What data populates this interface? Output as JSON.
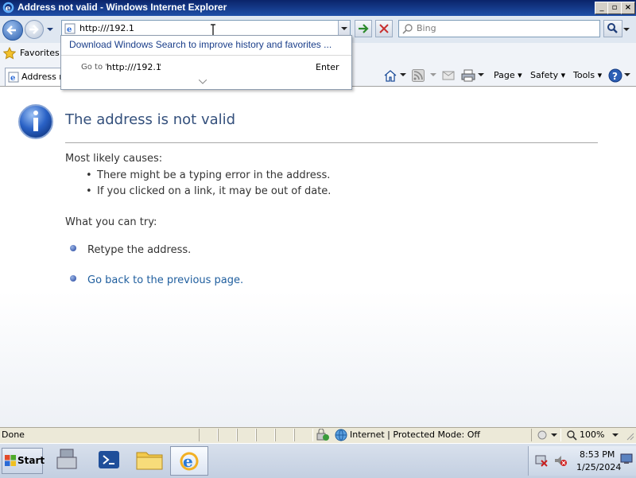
{
  "window": {
    "title": "Address not valid - Windows Internet Explorer",
    "minimize": "_",
    "maximize": "▫",
    "close": "×"
  },
  "address": {
    "url": "http:///192.1",
    "search_placeholder": "Bing"
  },
  "dropdown": {
    "suggestion": "Download Windows Search to improve history and favorites ...",
    "goto_prefix": "Go to '",
    "goto_url": "http:///192.1",
    "goto_suffix": "'",
    "enter_label": "Enter"
  },
  "favorites": {
    "label": "Favorites"
  },
  "tab": {
    "label": "Address n"
  },
  "command_bar": {
    "page": "Page ▾",
    "safety": "Safety ▾",
    "tools": "Tools ▾"
  },
  "page": {
    "heading": "The address is not valid",
    "causes_title": "Most likely causes:",
    "causes": [
      "There might be a typing error in the address.",
      "If you clicked on a link, it may be out of date."
    ],
    "try_title": "What you can try:",
    "actions": [
      "Retype the address.",
      "Go back to the previous page."
    ]
  },
  "status": {
    "text": "Done",
    "zone": "Internet | Protected Mode: Off",
    "zoom": "100%"
  },
  "taskbar": {
    "start": "Start",
    "time": "8:53 PM",
    "date": "1/25/2024"
  },
  "colors": {
    "titlebar": "#0a246a",
    "heading": "#34507c",
    "link": "#1f5e9e"
  }
}
